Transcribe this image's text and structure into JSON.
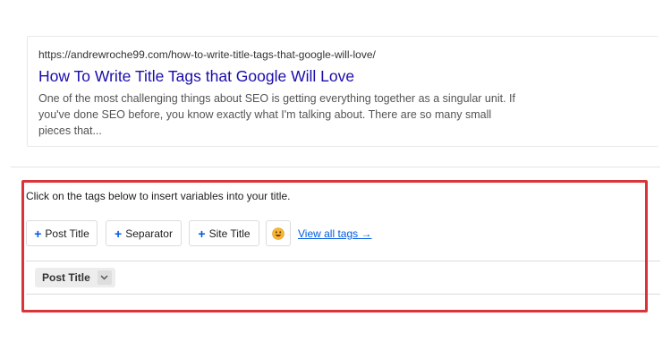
{
  "preview": {
    "url": "https://andrewroche99.com/how-to-write-title-tags-that-google-will-love/",
    "title": "How To Write Title Tags that Google Will Love",
    "description": "One of the most challenging things about SEO is getting everything together as a singular unit. If you've done SEO before, you know exactly what I'm talking about. There are so many small pieces that..."
  },
  "tags_panel": {
    "instruction": "Click on the tags below to insert variables into your title.",
    "buttons": [
      {
        "plus": "+",
        "label": "Post Title"
      },
      {
        "plus": "+",
        "label": "Separator"
      },
      {
        "plus": "+",
        "label": "Site Title"
      }
    ],
    "emoji_icon": "smiley-emoji-icon",
    "view_all_label": "View all tags →"
  },
  "editor": {
    "tag_label": "Post Title",
    "tag_caret_icon": "chevron-down-icon"
  },
  "colors": {
    "link_blue": "#1a0dab",
    "accent_blue": "#005ae0",
    "highlight_red": "#d9343a"
  }
}
